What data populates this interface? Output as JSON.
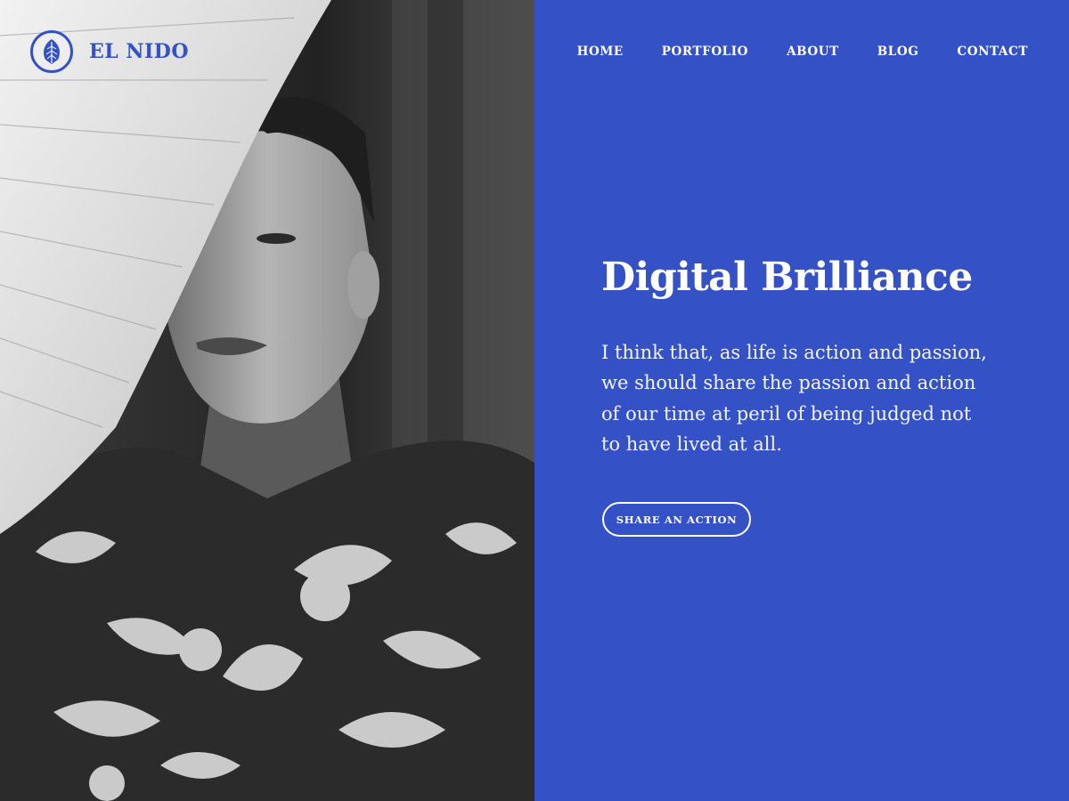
{
  "brand": {
    "name": "EL NIDO",
    "accent_color": "#3452c6",
    "logo_icon": "leaf-icon"
  },
  "nav": {
    "items": [
      {
        "label": "HOME"
      },
      {
        "label": "PORTFOLIO"
      },
      {
        "label": "ABOUT"
      },
      {
        "label": "BLOG"
      },
      {
        "label": "CONTACT"
      }
    ]
  },
  "hero": {
    "title": "Digital Brilliance",
    "body": "I think that, as life is action and passion, we should share the passion and action of our time at peril of being judged not to have lived at all.",
    "cta_label": "SHARE AN ACTION"
  },
  "photo": {
    "subject": "portrait-photo",
    "style": "black-and-white"
  }
}
